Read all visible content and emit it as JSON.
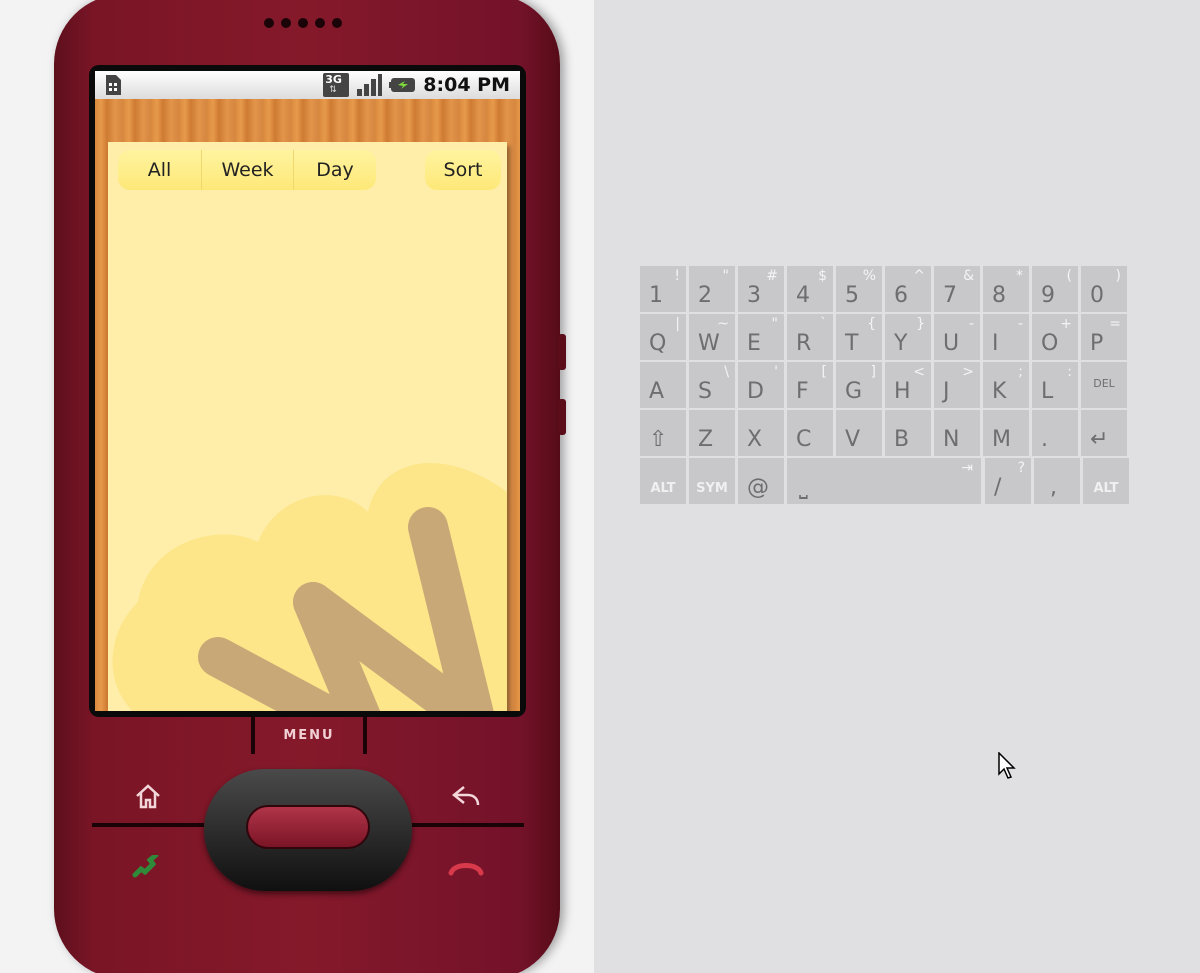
{
  "status_bar": {
    "time": "8:04 PM",
    "network": "3G"
  },
  "tabs": [
    {
      "label": "All"
    },
    {
      "label": "Week"
    },
    {
      "label": "Day"
    }
  ],
  "sort_label": "Sort",
  "phone": {
    "menu_label": "MENU"
  },
  "keyboard": {
    "row1": [
      {
        "main": "1",
        "alt": "!"
      },
      {
        "main": "2",
        "alt": "\""
      },
      {
        "main": "3",
        "alt": "#"
      },
      {
        "main": "4",
        "alt": "$"
      },
      {
        "main": "5",
        "alt": "%"
      },
      {
        "main": "6",
        "alt": "^"
      },
      {
        "main": "7",
        "alt": "&"
      },
      {
        "main": "8",
        "alt": "*"
      },
      {
        "main": "9",
        "alt": "("
      },
      {
        "main": "0",
        "alt": ")"
      }
    ],
    "row2": [
      {
        "main": "Q",
        "alt": "|"
      },
      {
        "main": "W",
        "alt": "~"
      },
      {
        "main": "E",
        "alt": "\""
      },
      {
        "main": "R",
        "alt": "`"
      },
      {
        "main": "T",
        "alt": "{"
      },
      {
        "main": "Y",
        "alt": "}"
      },
      {
        "main": "U",
        "alt": "-"
      },
      {
        "main": "I",
        "alt": "-"
      },
      {
        "main": "O",
        "alt": "+"
      },
      {
        "main": "P",
        "alt": "="
      }
    ],
    "row3": [
      {
        "main": "A",
        "alt": ""
      },
      {
        "main": "S",
        "alt": "\\"
      },
      {
        "main": "D",
        "alt": "'"
      },
      {
        "main": "F",
        "alt": "["
      },
      {
        "main": "G",
        "alt": "]"
      },
      {
        "main": "H",
        "alt": "<"
      },
      {
        "main": "J",
        "alt": ">"
      },
      {
        "main": "K",
        "alt": ";"
      },
      {
        "main": "L",
        "alt": ":"
      },
      {
        "main": "DEL",
        "alt": ""
      }
    ],
    "row4": [
      {
        "main": "⇧",
        "alt": ""
      },
      {
        "main": "Z",
        "alt": ""
      },
      {
        "main": "X",
        "alt": ""
      },
      {
        "main": "C",
        "alt": ""
      },
      {
        "main": "V",
        "alt": ""
      },
      {
        "main": "B",
        "alt": ""
      },
      {
        "main": "N",
        "alt": ""
      },
      {
        "main": "M",
        "alt": ""
      },
      {
        "main": ".",
        "alt": ""
      },
      {
        "main": "↵",
        "alt": ""
      }
    ],
    "row5": {
      "alt_left": "ALT",
      "sym": "SYM",
      "at": "@",
      "space": "⎵",
      "tab_glyph": "⇥",
      "slash": "/",
      "slash_alt": "?",
      "comma": ",",
      "alt_right": "ALT"
    }
  },
  "colors": {
    "phone_body": "#84192a",
    "note_paper": "#ffeeaa",
    "tab_yellow": "#fde878",
    "wood": "#d9893e",
    "key_gray": "#c8c8ca"
  }
}
